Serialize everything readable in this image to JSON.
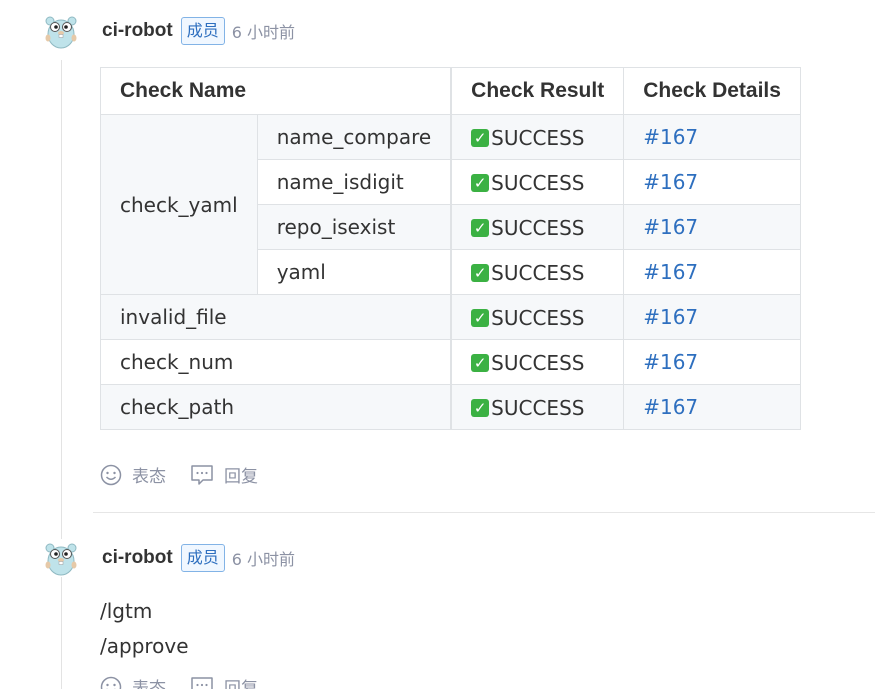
{
  "comments": [
    {
      "author": "ci-robot",
      "role": "成员",
      "time": "6 小时前",
      "table": {
        "headers": [
          "Check Name",
          "Check Result",
          "Check Details"
        ],
        "group_name": "check_yaml",
        "group_rows": [
          {
            "name": "name_compare",
            "result": "SUCCESS",
            "detail": "#167"
          },
          {
            "name": "name_isdigit",
            "result": "SUCCESS",
            "detail": "#167"
          },
          {
            "name": "repo_isexist",
            "result": "SUCCESS",
            "detail": "#167"
          },
          {
            "name": "yaml",
            "result": "SUCCESS",
            "detail": "#167"
          }
        ],
        "rows": [
          {
            "name": "invalid_file",
            "result": "SUCCESS",
            "detail": "#167"
          },
          {
            "name": "check_num",
            "result": "SUCCESS",
            "detail": "#167"
          },
          {
            "name": "check_path",
            "result": "SUCCESS",
            "detail": "#167"
          }
        ]
      },
      "actions": {
        "react_label": "表态",
        "reply_label": "回复"
      }
    },
    {
      "author": "ci-robot",
      "role": "成员",
      "time": "6 小时前",
      "lines": [
        "/lgtm",
        "/approve"
      ],
      "actions": {
        "react_label": "表态",
        "reply_label": "回复"
      }
    }
  ],
  "icons": {
    "avatar": "gopher-avatar",
    "check": "check-mark-icon",
    "react": "smiley-icon",
    "reply": "comment-icon"
  },
  "colors": {
    "success": "#3bb143",
    "link": "#2e6fbf",
    "badge_border": "#82b3e6",
    "muted": "#8c92a4"
  }
}
